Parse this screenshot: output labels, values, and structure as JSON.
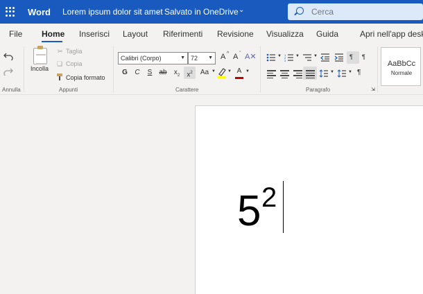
{
  "titlebar": {
    "app_name": "Word",
    "doc_title": "Lorem ipsum dolor sit amet",
    "separator": "-",
    "save_status": "Salvato in OneDrive",
    "search_placeholder": "Cerca"
  },
  "tabs": [
    "File",
    "Home",
    "Inserisci",
    "Layout",
    "Riferimenti",
    "Revisione",
    "Visualizza",
    "Guida",
    "Apri nell'app desktop"
  ],
  "active_tab": "Home",
  "ribbon": {
    "undo_group": "Annulla",
    "clipboard": {
      "paste": "Incolla",
      "cut": "Taglia",
      "copy": "Copia",
      "format_painter": "Copia formato",
      "group": "Appunti"
    },
    "font": {
      "name": "Calibri (Corpo)",
      "size": "72",
      "grow": "A",
      "shrink": "A",
      "bold": "G",
      "italic": "C",
      "underline": "S",
      "strikethrough": "ab",
      "subscript": "x",
      "subscript_mark": "2",
      "superscript": "x",
      "superscript_mark": "2",
      "change_case": "Aa",
      "font_color": "A",
      "group": "Carattere"
    },
    "paragraph": {
      "group": "Paragrafo",
      "show_marks": "¶",
      "ltr": "¶"
    },
    "styles": {
      "sample": "AaBbCc",
      "name": "Normale"
    }
  },
  "document": {
    "base_text": "5",
    "superscript_text": "2"
  },
  "colors": {
    "brand": "#185abd",
    "highlight": "#ffff00",
    "font_color": "#c00000"
  }
}
